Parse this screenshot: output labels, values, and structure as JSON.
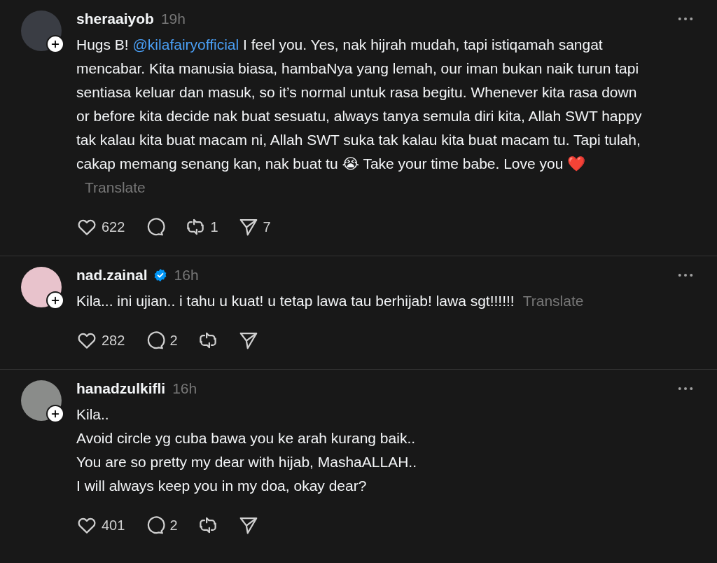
{
  "comments": [
    {
      "username": "sheraaiyob",
      "verified": false,
      "time": "19h",
      "body": [
        {
          "kind": "text",
          "text": "Hugs B! "
        },
        {
          "kind": "mention",
          "text": "@kilafairyofficial"
        },
        {
          "kind": "text",
          "text": " I feel you. Yes, nak hijrah mudah, tapi istiqamah sangat mencabar. Kita manusia biasa, hambaNya yang lemah, our iman bukan naik turun tapi sentiasa keluar dan masuk, so it’s normal untuk rasa begitu. Whenever kita rasa down or before kita decide nak buat sesuatu, always tanya semula diri kita, Allah SWT happy tak kalau kita buat macam ni, Allah SWT suka tak kalau kita buat macam tu. Tapi tulah, cakap memang senang kan, nak buat tu 😭 Take your time babe. Love you ❤️"
        }
      ],
      "translate": "Translate",
      "likes": "622",
      "reposts": "1",
      "shares": "7"
    },
    {
      "username": "nad.zainal",
      "verified": true,
      "time": "16h",
      "body": [
        {
          "kind": "text",
          "text": "Kila... ini ujian.. i tahu u kuat! u tetap lawa tau berhijab! lawa sgt!!!!!!"
        }
      ],
      "translate": "Translate",
      "likes": "282",
      "replies": "2"
    },
    {
      "username": "hanadzulkifli",
      "verified": false,
      "time": "16h",
      "body": [
        {
          "kind": "text",
          "text": "Kila..\nAvoid circle yg cuba bawa you ke arah kurang baik..\nYou are so pretty my dear with hijab, MashaALLAH..\nI will always keep you in my doa, okay dear?"
        }
      ],
      "likes": "401",
      "replies": "2"
    }
  ]
}
